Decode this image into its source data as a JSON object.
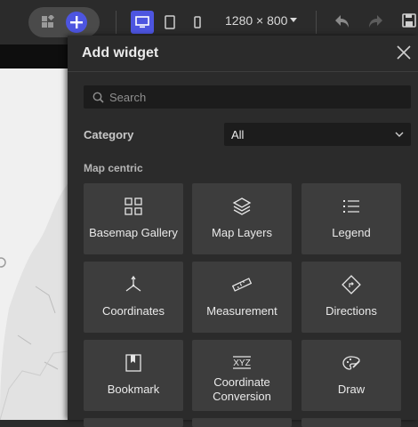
{
  "toolbar": {
    "resolution": "1280 × 800",
    "icons": [
      "widgets-grid-icon",
      "add-plus-icon",
      "desktop-icon",
      "tablet-icon",
      "mobile-icon",
      "chevron-down-icon",
      "undo-icon",
      "redo-icon",
      "save-icon"
    ]
  },
  "panel": {
    "title": "Add widget",
    "search_placeholder": "Search",
    "category_label": "Category",
    "category_value": "All",
    "section_label": "Map centric",
    "widgets": [
      {
        "label": "Basemap Gallery",
        "icon": "basemap-gallery-icon"
      },
      {
        "label": "Map Layers",
        "icon": "map-layers-icon"
      },
      {
        "label": "Legend",
        "icon": "legend-icon"
      },
      {
        "label": "Coordinates",
        "icon": "coordinates-icon"
      },
      {
        "label": "Measurement",
        "icon": "measurement-icon"
      },
      {
        "label": "Directions",
        "icon": "directions-icon"
      },
      {
        "label": "Bookmark",
        "icon": "bookmark-icon"
      },
      {
        "label": "Coordinate Conversion",
        "icon": "coordinate-conversion-icon"
      },
      {
        "label": "Draw",
        "icon": "draw-icon"
      }
    ]
  },
  "colors": {
    "accent": "#4d55e0",
    "panel_bg": "#2b2b2b",
    "tile_bg": "#3d3d3d",
    "input_bg": "#1c1c1c"
  }
}
